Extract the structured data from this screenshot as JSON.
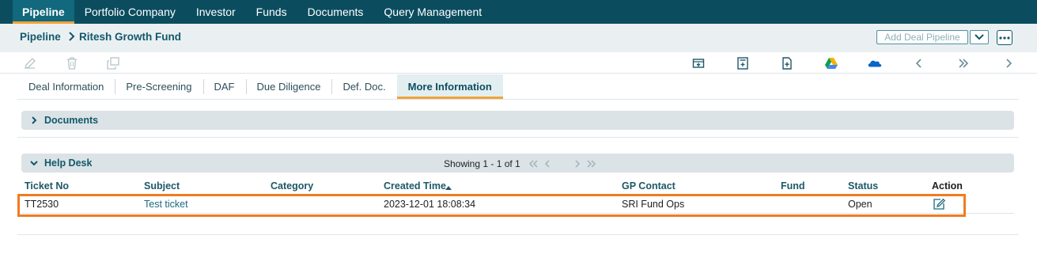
{
  "nav": {
    "items": [
      "Pipeline",
      "Portfolio Company",
      "Investor",
      "Funds",
      "Documents",
      "Query Management"
    ],
    "active_index": 0
  },
  "breadcrumb": {
    "root": "Pipeline",
    "current": "Ritesh Growth Fund"
  },
  "header_actions": {
    "add_label": "Add Deal Pipeline"
  },
  "toolbar": {
    "left_icons": [
      "edit-icon",
      "delete-icon",
      "copy-icon"
    ],
    "right_icons": [
      "add-row-icon",
      "calculator-icon",
      "new-document-icon",
      "google-drive-icon",
      "onedrive-icon",
      "prev-icon",
      "fast-forward-icon",
      "next-icon"
    ]
  },
  "tabs": [
    "Deal Information",
    "Pre-Screening",
    "DAF",
    "Due Diligence",
    "Def. Doc.",
    "More Information"
  ],
  "active_tab": "More Information",
  "documents_section": {
    "title": "Documents",
    "expanded": false
  },
  "helpdesk": {
    "title": "Help Desk",
    "expanded": true,
    "pager_text": "Showing 1 - 1 of 1",
    "columns": [
      "Ticket No",
      "Subject",
      "Category",
      "Created Time",
      "GP Contact",
      "Fund",
      "Status",
      "Action"
    ],
    "sort_column": "Created Time",
    "sort_direction": "asc",
    "rows": [
      {
        "ticket_no": "TT2530",
        "subject": "Test ticket",
        "category": "",
        "created_time": "2023-12-01 18:08:34",
        "gp_contact": "SRI Fund Ops",
        "fund": "",
        "status": "Open",
        "action_icon": "edit-icon"
      }
    ]
  },
  "colors": {
    "nav_bg": "#0b4d5f",
    "accent": "#f2a23a",
    "highlight": "#f07b22",
    "brand_text": "#12586b"
  }
}
